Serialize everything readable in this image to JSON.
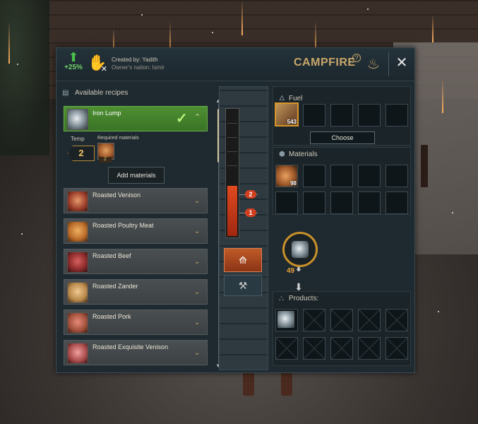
{
  "header": {
    "boost": "+25%",
    "created_by": "Created by: Yadith",
    "owners_nation": "Owner's nation: Ismir",
    "title": "CAMPFIRE",
    "help": "?"
  },
  "recipes": {
    "heading": "Available recipes",
    "selected": {
      "name": "Iron Lump",
      "temp_label": "Temp",
      "temp_value": "2",
      "required_label": "Required materials",
      "required_count": "2",
      "add_button": "Add materials"
    },
    "items": [
      {
        "name": "Roasted Venison"
      },
      {
        "name": "Roasted Poultry Meat"
      },
      {
        "name": "Roasted Beef"
      },
      {
        "name": "Roasted Zander"
      },
      {
        "name": "Roasted Pork"
      },
      {
        "name": "Roasted Exquisite Venison"
      }
    ]
  },
  "furnace": {
    "heat_fraction": 0.4,
    "marker_high": "2",
    "marker_low": "1"
  },
  "fuel": {
    "heading": "Fuel",
    "count": "543",
    "choose_button": "Choose"
  },
  "materials": {
    "heading": "Materials",
    "count": "98"
  },
  "output": {
    "count": "49"
  },
  "products": {
    "heading": "Products:"
  }
}
